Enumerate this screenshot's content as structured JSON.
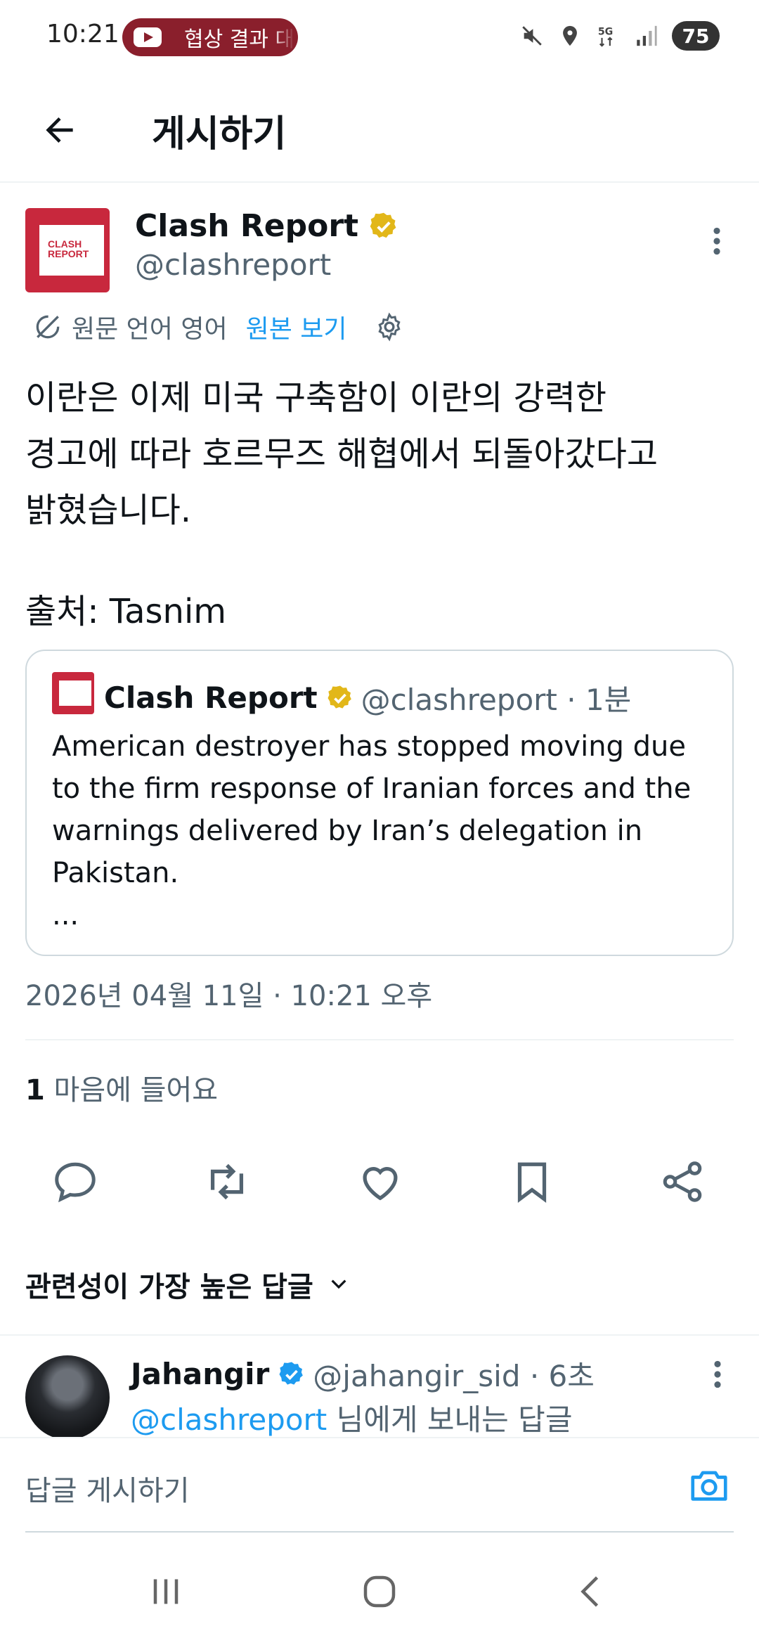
{
  "status_bar": {
    "time": "10:21",
    "notification_pill": "협상 결과 대",
    "battery": "75",
    "network": "5G"
  },
  "header": {
    "title": "게시하기"
  },
  "tweet": {
    "author_name": "Clash Report",
    "author_handle": "@clashreport",
    "avatar_text": "CLASH REPORT",
    "translation_label": "원문 언어 영어",
    "view_original": "원본 보기",
    "body_lines": [
      "이란은 이제 미국 구축함이 이란의 강력한",
      "경고에 따라 호르무즈 해협에서 되돌아갔다고",
      "밝혔습니다."
    ],
    "source": "출처: Tasnim",
    "timestamp": "2026년 04월 11일 · 10:21 오후",
    "likes_count": "1",
    "likes_label": " 마음에 들어요"
  },
  "quote": {
    "author_name": "Clash Report",
    "author_handle": "@clashreport · 1분",
    "text_lines": [
      "American destroyer has stopped moving due",
      "to the firm response of Iranian forces and the",
      "warnings delivered by Iran’s delegation in",
      "Pakistan.",
      "..."
    ]
  },
  "replies": {
    "sort_label": "관련성이 가장 높은 답글"
  },
  "reply": {
    "author_name": "Jahangir",
    "author_handle": "@jahangir_sid · 6초",
    "mention": "@clashreport",
    "reply_to_suffix": " 님에게 보내는 답글"
  },
  "composer": {
    "placeholder": "답글 게시하기"
  },
  "colors": {
    "accent": "#1d9bf0",
    "brand_red": "#c8283d",
    "gold_badge": "#e2b719",
    "muted": "#536471"
  }
}
